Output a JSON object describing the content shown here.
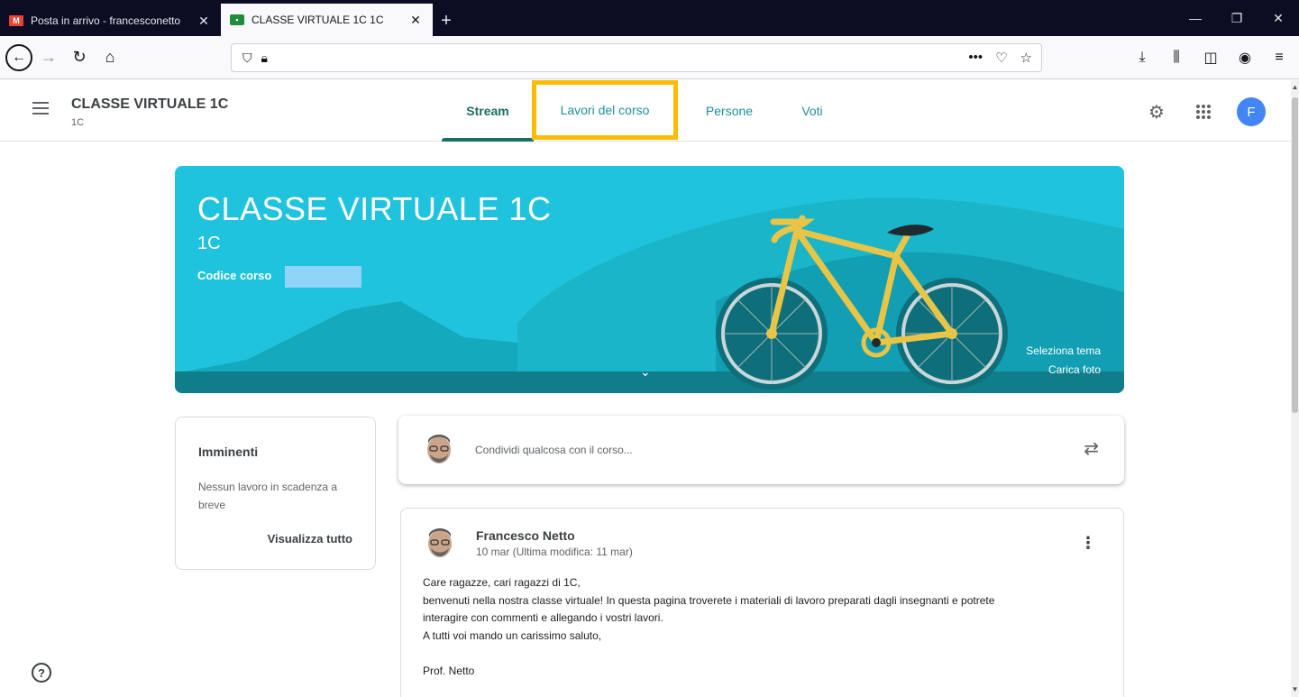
{
  "browser": {
    "tabs": [
      {
        "title": "Posta in arrivo - francesconetto",
        "close": "✕",
        "favicon": "gmail-icon"
      },
      {
        "title": "CLASSE VIRTUALE 1C 1C",
        "close": "✕",
        "favicon": "classroom-icon"
      }
    ],
    "new_tab": "+",
    "window_controls": {
      "minimize": "—",
      "restore": "❐",
      "close": "✕"
    },
    "url": "",
    "url_menu": "•••"
  },
  "header": {
    "class_name": "CLASSE VIRTUALE 1C",
    "section": "1C",
    "tabs": [
      {
        "label": "Stream"
      },
      {
        "label": "Lavori del corso"
      },
      {
        "label": "Persone"
      },
      {
        "label": "Voti"
      }
    ],
    "avatar_letter": "F"
  },
  "banner": {
    "title": "CLASSE VIRTUALE 1C",
    "section": "1C",
    "code_label": "Codice corso",
    "select_theme": "Seleziona tema",
    "upload_photo": "Carica foto"
  },
  "upcoming": {
    "title": "Imminenti",
    "empty_text": "Nessun lavoro in scadenza a breve",
    "view_all": "Visualizza tutto"
  },
  "share": {
    "placeholder": "Condividi qualcosa con il corso..."
  },
  "post": {
    "author": "Francesco Netto",
    "date": "10 mar (Ultima modifica: 11 mar)",
    "lines": [
      "Care ragazze, cari ragazzi di 1C,",
      "benvenuti nella nostra classe virtuale! In questa pagina troverete i materiali di lavoro preparati dagli insegnanti e potrete",
      "interagire con commenti e allegando i vostri lavori.",
      "A tutti voi mando un carissimo saluto,"
    ],
    "signature": "Prof. Netto"
  },
  "help": "?",
  "colors": {
    "banner": "#20c3dd",
    "highlight": "#fbbc04",
    "tab_text": "#1e8e9e",
    "avatar": "#4285f4"
  }
}
